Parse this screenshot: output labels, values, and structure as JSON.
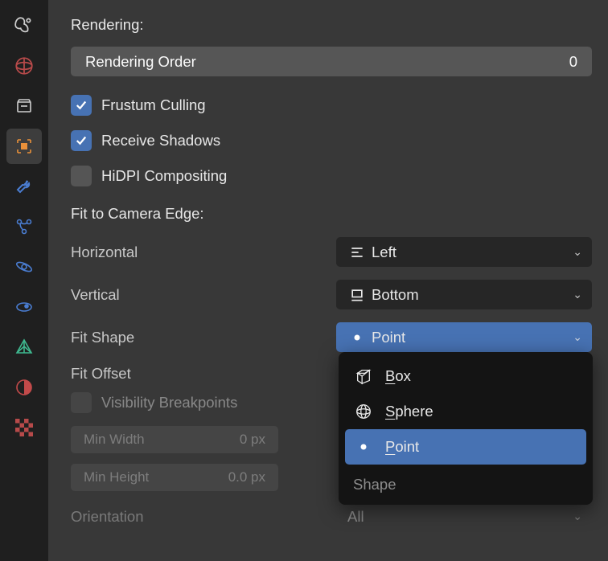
{
  "sidebarTabs": [
    "render",
    "world",
    "output",
    "object",
    "wrench",
    "constraints",
    "physics",
    "rigid",
    "modifier",
    "particle",
    "texture"
  ],
  "activeTab": 3,
  "labels": {
    "renderingSection": "Rendering:",
    "fitSection": "Fit to Camera Edge:"
  },
  "renderingOrder": {
    "label": "Rendering Order",
    "value": "0"
  },
  "checks": {
    "frustum": {
      "label": "Frustum Culling",
      "checked": true
    },
    "receiveShadows": {
      "label": "Receive Shadows",
      "checked": true
    },
    "hidpi": {
      "label": "HiDPI Compositing",
      "checked": false
    },
    "visibility": {
      "label": "Visibility Breakpoints",
      "checked": false
    }
  },
  "props": {
    "horizontal": {
      "label": "Horizontal",
      "value": "Left",
      "icon": "halign"
    },
    "vertical": {
      "label": "Vertical",
      "value": "Bottom",
      "icon": "valign"
    },
    "fitShape": {
      "label": "Fit Shape",
      "value": "Point",
      "icon": "dot"
    },
    "fitOffset": {
      "label": "Fit Offset"
    },
    "orientation": {
      "label": "Orientation",
      "value": "All"
    }
  },
  "shapeMenu": {
    "title": "Shape",
    "options": [
      {
        "id": "box",
        "label": "Box",
        "under": "B",
        "icon": "box"
      },
      {
        "id": "sphere",
        "label": "Sphere",
        "under": "S",
        "icon": "sphere"
      },
      {
        "id": "point",
        "label": "Point",
        "under": "P",
        "icon": "dot",
        "selected": true
      }
    ]
  },
  "vis": {
    "minWidth": {
      "label": "Min Width",
      "value": "0 px"
    },
    "minHeight": {
      "label": "Min Height",
      "value": "0.0 px"
    }
  }
}
